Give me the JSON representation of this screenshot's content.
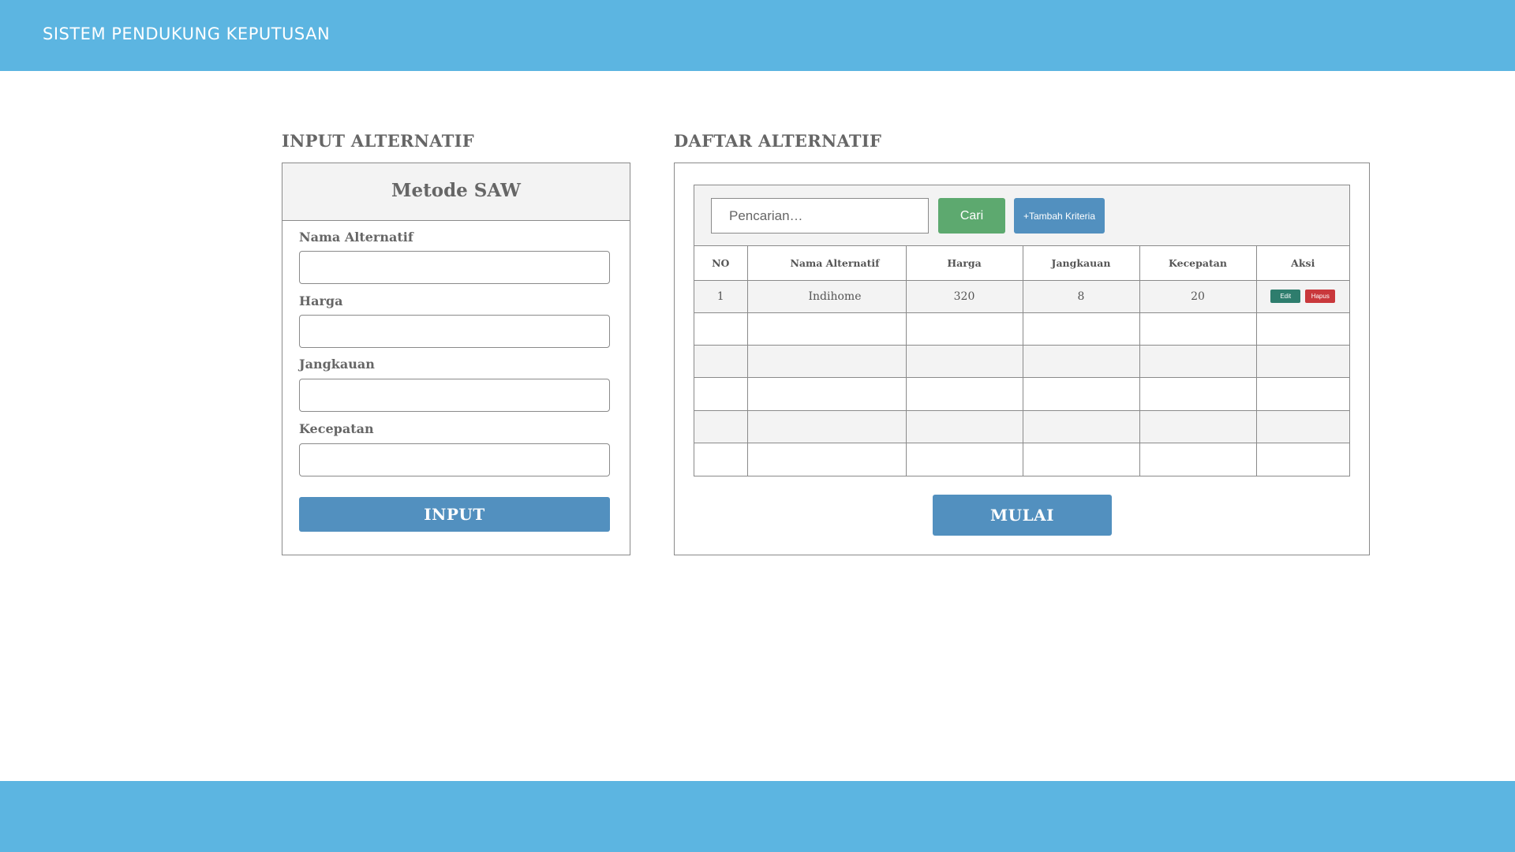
{
  "app": {
    "title": "SISTEM PENDUKUNG KEPUTUSAN"
  },
  "colors": {
    "bar": "#5cb5e1",
    "primary_button": "#5290bf",
    "search_button": "#5da96f",
    "edit_button": "#2e7d6d",
    "delete_button": "#c9383c"
  },
  "input_section": {
    "title": "INPUT ALTERNATIF",
    "panel_title": "Metode SAW",
    "fields": [
      {
        "label": "Nama Alternatif",
        "value": ""
      },
      {
        "label": "Harga",
        "value": ""
      },
      {
        "label": "Jangkauan",
        "value": ""
      },
      {
        "label": "Kecepatan",
        "value": ""
      }
    ],
    "submit_label": "INPUT"
  },
  "list_section": {
    "title": "DAFTAR ALTERNATIF",
    "search": {
      "placeholder": "Pencarian…",
      "value": ""
    },
    "search_button": "Cari",
    "add_criteria_button": "+Tambah Kriteria",
    "table": {
      "headers": [
        "NO",
        "Nama Alternatif",
        "Harga",
        "Jangkauan",
        "Kecepatan",
        "Aksi"
      ],
      "rows": [
        {
          "no": "1",
          "name": "Indihome",
          "harga": "320",
          "jangkauan": "8",
          "kecepatan": "20",
          "edit_label": "Edit",
          "delete_label": "Hapus"
        }
      ]
    },
    "start_button": "MULAI"
  }
}
